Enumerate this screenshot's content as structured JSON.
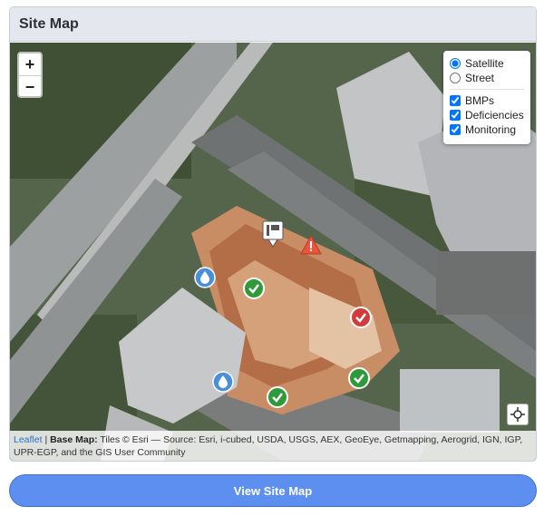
{
  "card": {
    "title": "Site Map"
  },
  "map": {
    "zoom_in": "+",
    "zoom_out": "−",
    "base_layers": [
      "Satellite",
      "Street"
    ],
    "selected_base_layer": "Satellite",
    "overlays": [
      "BMPs",
      "Deficiencies",
      "Monitoring"
    ],
    "overlays_checked": [
      true,
      true,
      true
    ],
    "attribution": {
      "leaflet": "Leaflet",
      "separator": " | ",
      "base_map_label": "Base Map:",
      "text": " Tiles © Esri — Source: Esri, i-cubed, USDA, USGS, AEX, GeoEye, Getmapping, Aerogrid, IGN, IGP, UPR-EGP, and the GIS User Community"
    },
    "colors": {
      "check_marker": "#2e9a3a",
      "deficiency_marker": "#d23b3b",
      "warning_marker": "#e8553c",
      "water_marker": "#4a90d9",
      "accent_button": "#5c8ff0"
    }
  },
  "actions": {
    "view_site_map": "View Site Map"
  }
}
